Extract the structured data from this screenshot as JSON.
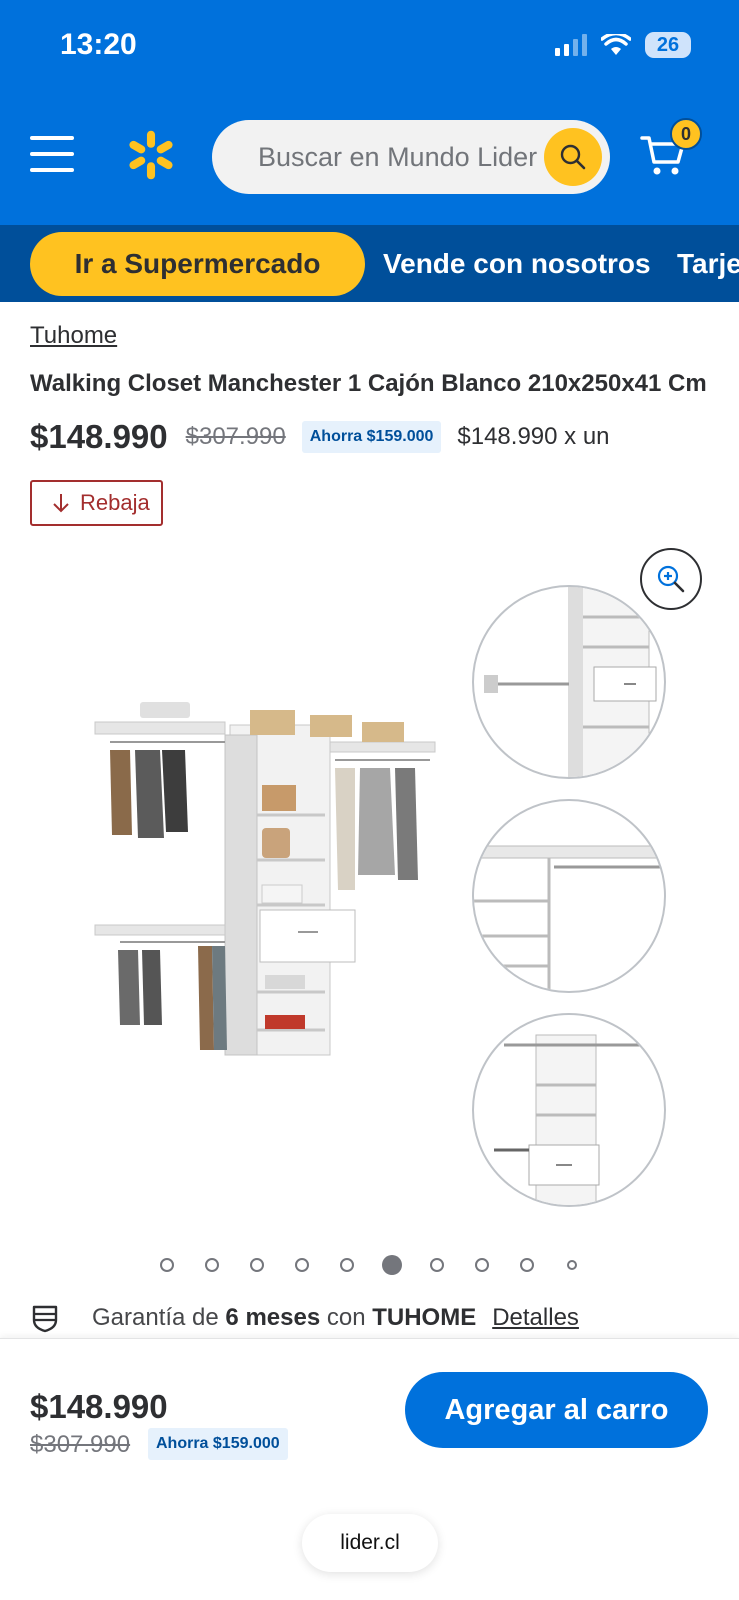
{
  "status_bar": {
    "time": "13:20",
    "battery": "26"
  },
  "header": {
    "search_placeholder": "Buscar en Mundo Lider",
    "cart_count": "0"
  },
  "nav": {
    "primary": "Ir a Supermercado",
    "links": [
      "Vende con nosotros",
      "Tarje"
    ]
  },
  "product": {
    "brand": "Tuhome",
    "title": "Walking Closet Manchester 1 Cajón Blanco 210x250x41 Cm",
    "price": "$148.990",
    "old_price": "$307.990",
    "savings": "Ahorra $159.000",
    "unit_price": "$148.990 x un",
    "tag": "Rebaja"
  },
  "gallery": {
    "image_count": 10,
    "active_index": 5
  },
  "warranty": {
    "prefix": "Garantía de ",
    "duration": "6 meses",
    "middle": " con ",
    "brand": "TUHOME",
    "link": "Detalles"
  },
  "bottom_bar": {
    "price": "$148.990",
    "old_price": "$307.990",
    "savings": "Ahorra $159.000",
    "add_to_cart": "Agregar al carro"
  },
  "browser": {
    "url": "lider.cl"
  },
  "colors": {
    "brand_blue": "#0071dc",
    "nav_blue": "#004f9a",
    "accent_yellow": "#ffc220",
    "sale_red": "#a32e2e"
  }
}
